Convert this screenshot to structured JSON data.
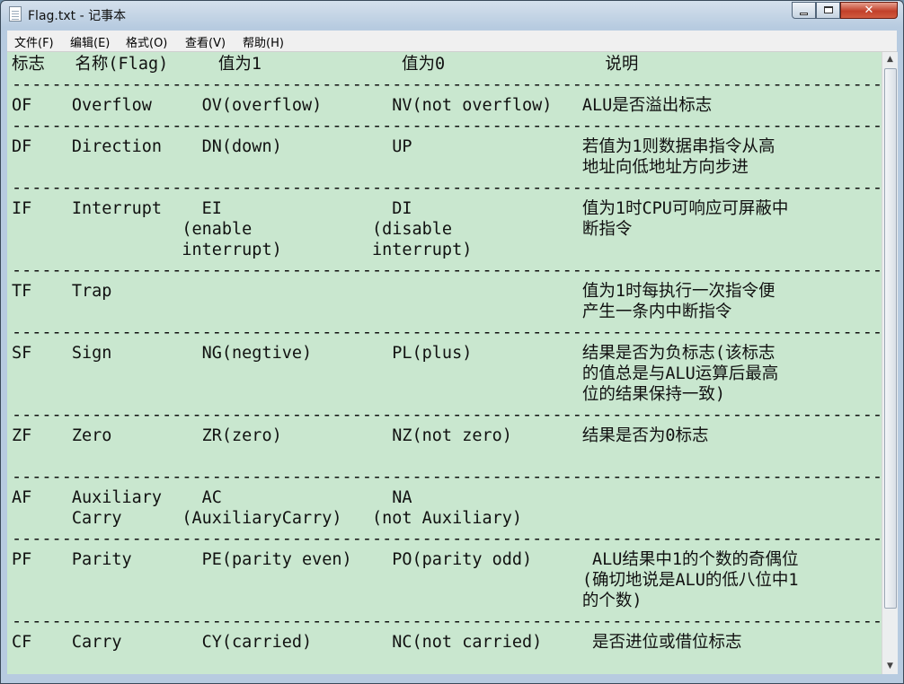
{
  "window": {
    "title": "Flag.txt - 记事本",
    "minimize": "",
    "maximize": "",
    "close": "✕"
  },
  "menu": [
    "文件(F)",
    "编辑(E)",
    "格式(O)",
    "查看(V)",
    "帮助(H)"
  ],
  "document": {
    "lines": [
      "标志   名称(Flag)     值为1              值为0                说明",
      "----------------------------------------------------------------------------------------------------------------------",
      "OF    Overflow     OV(overflow)       NV(not overflow)   ALU是否溢出标志",
      "----------------------------------------------------------------------------------------------------------------------",
      "DF    Direction    DN(down)           UP                 若值为1则数据串指令从高",
      "                                                         地址向低地址方向步进",
      "----------------------------------------------------------------------------------------------------------------------",
      "IF    Interrupt    EI                 DI                 值为1时CPU可响应可屏蔽中",
      "                 (enable            (disable             断指令",
      "                 interrupt)         interrupt)",
      "----------------------------------------------------------------------------------------------------------------------",
      "TF    Trap                                               值为1时每执行一次指令便",
      "                                                         产生一条内中断指令",
      "----------------------------------------------------------------------------------------------------------------------",
      "SF    Sign         NG(negtive)        PL(plus)           结果是否为负标志(该标志",
      "                                                         的值总是与ALU运算后最高",
      "                                                         位的结果保持一致)",
      "----------------------------------------------------------------------------------------------------------------------",
      "ZF    Zero         ZR(zero)           NZ(not zero)       结果是否为0标志",
      "",
      "----------------------------------------------------------------------------------------------------------------------",
      "AF    Auxiliary    AC                 NA",
      "      Carry      (AuxiliaryCarry)   (not Auxiliary)",
      "----------------------------------------------------------------------------------------------------------------------",
      "PF    Parity       PE(parity even)    PO(parity odd)      ALU结果中1的个数的奇偶位",
      "                                                         (确切地说是ALU的低八位中1",
      "                                                         的个数)",
      "----------------------------------------------------------------------------------------------------------------------",
      "CF    Carry        CY(carried)        NC(not carried)     是否进位或借位标志"
    ]
  }
}
